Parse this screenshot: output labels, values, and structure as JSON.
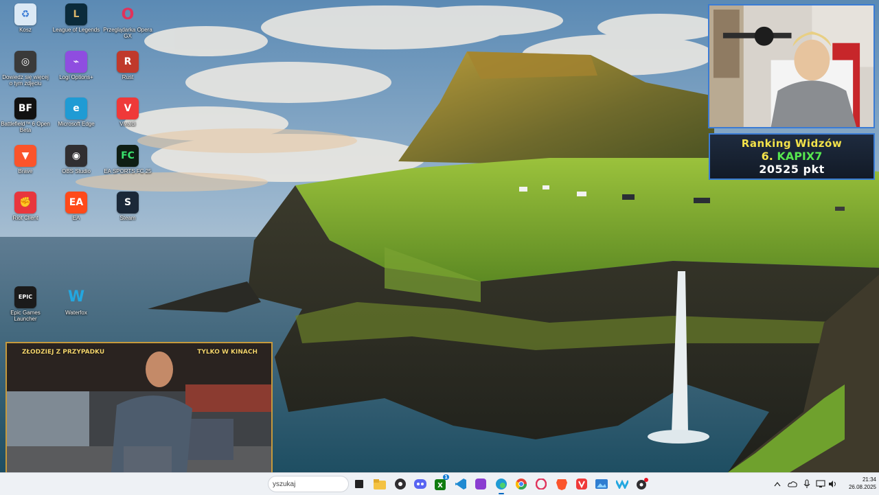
{
  "desktop": {
    "icons": [
      {
        "label": "Kosz",
        "icon": "recycle-bin-icon"
      },
      {
        "label": "League of Legends",
        "icon": "league-of-legends-icon"
      },
      {
        "label": "Przeglądarka Opera GX",
        "icon": "opera-gx-icon"
      },
      {
        "label": "Dowiedz się więcej o tym zdjęciu",
        "icon": "camera-icon"
      },
      {
        "label": "Logi Options+",
        "icon": "logi-options-icon"
      },
      {
        "label": "Rust",
        "icon": "rust-icon"
      },
      {
        "label": "Battlefield™ 6 Open Beta",
        "icon": "battlefield-icon"
      },
      {
        "label": "Microsoft Edge",
        "icon": "edge-icon"
      },
      {
        "label": "Vivaldi",
        "icon": "vivaldi-icon"
      },
      {
        "label": "Brave",
        "icon": "brave-icon"
      },
      {
        "label": "OBS Studio",
        "icon": "obs-icon"
      },
      {
        "label": "EA SPORTS FC 25",
        "icon": "fc25-icon"
      },
      {
        "label": "Riot Client",
        "icon": "riot-icon"
      },
      {
        "label": "EA",
        "icon": "ea-icon"
      },
      {
        "label": "Steam",
        "icon": "steam-icon"
      },
      {
        "label": "Epic Games Launcher",
        "icon": "epic-games-icon"
      },
      {
        "label": "Waterfox",
        "icon": "waterfox-icon"
      }
    ]
  },
  "overlay": {
    "ranking_title": "Ranking Widzów",
    "rank_number": "6.",
    "rank_name": "KAPIX7",
    "points": "20525 pkt",
    "video_caption_left": "ZŁODZIEJ Z PRZYPADKU",
    "video_caption_right": "TYLKO W KINACH"
  },
  "taskbar": {
    "search_placeholder": "yszukaj",
    "apps": [
      "task-view-icon",
      "file-explorer-icon",
      "obs-icon",
      "discord-icon",
      "xbox-icon",
      "vscode-icon",
      "clipchamp-icon",
      "edge-icon",
      "chrome-icon",
      "opera-gx-icon",
      "brave-icon",
      "vivaldi-icon",
      "photos-icon",
      "waterfox-icon",
      "obs-recording-icon"
    ],
    "xbox_badge": "1",
    "time": "21:34",
    "date": "26.08.2025"
  },
  "colors": {
    "accent": "#3a7bd5",
    "rank_yellow": "#f3e24a",
    "rank_green": "#57e84f"
  }
}
